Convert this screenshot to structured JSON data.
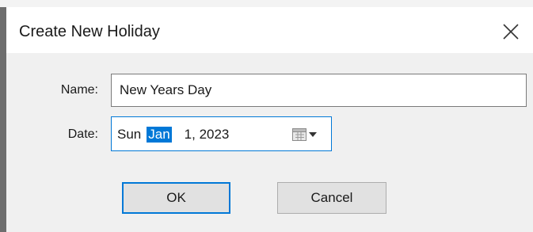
{
  "dialog": {
    "title": "Create New Holiday",
    "close_icon": "close-icon"
  },
  "form": {
    "name_label": "Name:",
    "name_value": "New Years Day",
    "date_label": "Date:",
    "date": {
      "weekday": "Sun",
      "month": "Jan",
      "day_year": "1, 2023",
      "selected_segment": "month",
      "picker_icon": "calendar-dropdown-icon"
    }
  },
  "buttons": {
    "ok_label": "OK",
    "cancel_label": "Cancel"
  },
  "colors": {
    "accent": "#0078d7",
    "dialog_background": "#f0f0f0",
    "titlebar_background": "#ffffff",
    "button_face": "#e1e1e1"
  }
}
